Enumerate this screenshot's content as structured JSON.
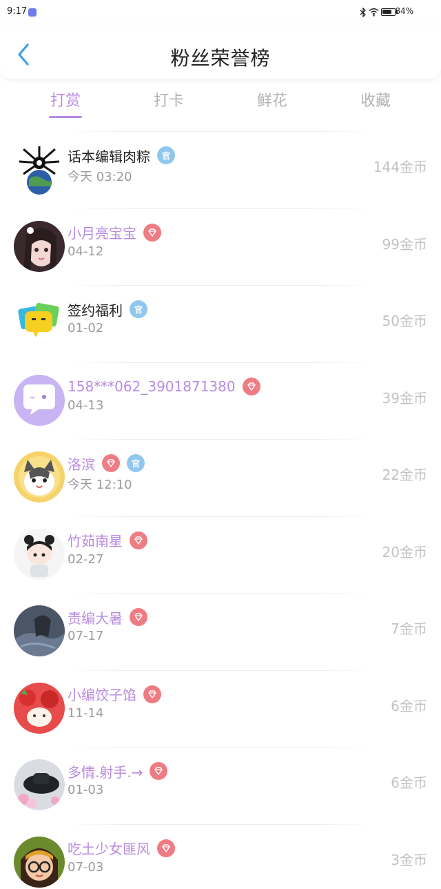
{
  "status_bar": {
    "time": "9:17",
    "battery": "84%",
    "battery_level": 0.84
  },
  "header": {
    "title": "粉丝荣誉榜"
  },
  "tabs": [
    {
      "label": "打赏",
      "active": true
    },
    {
      "label": "打卡",
      "active": false
    },
    {
      "label": "鲜花",
      "active": false
    },
    {
      "label": "收藏",
      "active": false
    }
  ],
  "badges": {
    "official": "官"
  },
  "colors": {
    "accent": "#b88be0",
    "gem_badge": "#ef7c83",
    "official_badge": "#8fc7ef",
    "muted": "#c2c2c2"
  },
  "fans": [
    {
      "name": "话本编辑肉粽",
      "time": "今天 03:20",
      "amount": "144金币",
      "gem": false,
      "official": true,
      "dark": true,
      "avatar_icon": "spider-globe-icon"
    },
    {
      "name": "小月亮宝宝",
      "time": "04-12",
      "amount": "99金币",
      "gem": true,
      "official": false,
      "dark": false,
      "avatar_icon": "girl-portrait-icon"
    },
    {
      "name": "签约福利",
      "time": "01-02",
      "amount": "50金币",
      "gem": false,
      "official": true,
      "dark": true,
      "avatar_icon": "chat-bubble-face-icon"
    },
    {
      "name": "158***062_3901871380",
      "time": "04-13",
      "amount": "39金币",
      "gem": true,
      "official": false,
      "dark": false,
      "avatar_icon": "default-chat-avatar-icon"
    },
    {
      "name": "洛滨",
      "time": "今天 12:10",
      "amount": "22金币",
      "gem": true,
      "official": true,
      "dark": false,
      "avatar_icon": "cat-avatar-icon"
    },
    {
      "name": "竹茹南星",
      "time": "02-27",
      "amount": "20金币",
      "gem": true,
      "official": false,
      "dark": false,
      "avatar_icon": "cartoon-girl-icon"
    },
    {
      "name": "责编大暑",
      "time": "07-17",
      "amount": "7金币",
      "gem": true,
      "official": false,
      "dark": false,
      "avatar_icon": "dark-scene-icon"
    },
    {
      "name": "小编饺子馅",
      "time": "11-14",
      "amount": "6金币",
      "gem": true,
      "official": false,
      "dark": false,
      "avatar_icon": "strawberry-icon"
    },
    {
      "name": "多情.射手.→",
      "time": "01-03",
      "amount": "6金币",
      "gem": true,
      "official": false,
      "dark": false,
      "avatar_icon": "hat-flowers-icon"
    },
    {
      "name": "吃土少女匪风",
      "time": "07-03",
      "amount": "3金币",
      "gem": true,
      "official": false,
      "dark": false,
      "avatar_icon": "glasses-girl-icon"
    }
  ]
}
